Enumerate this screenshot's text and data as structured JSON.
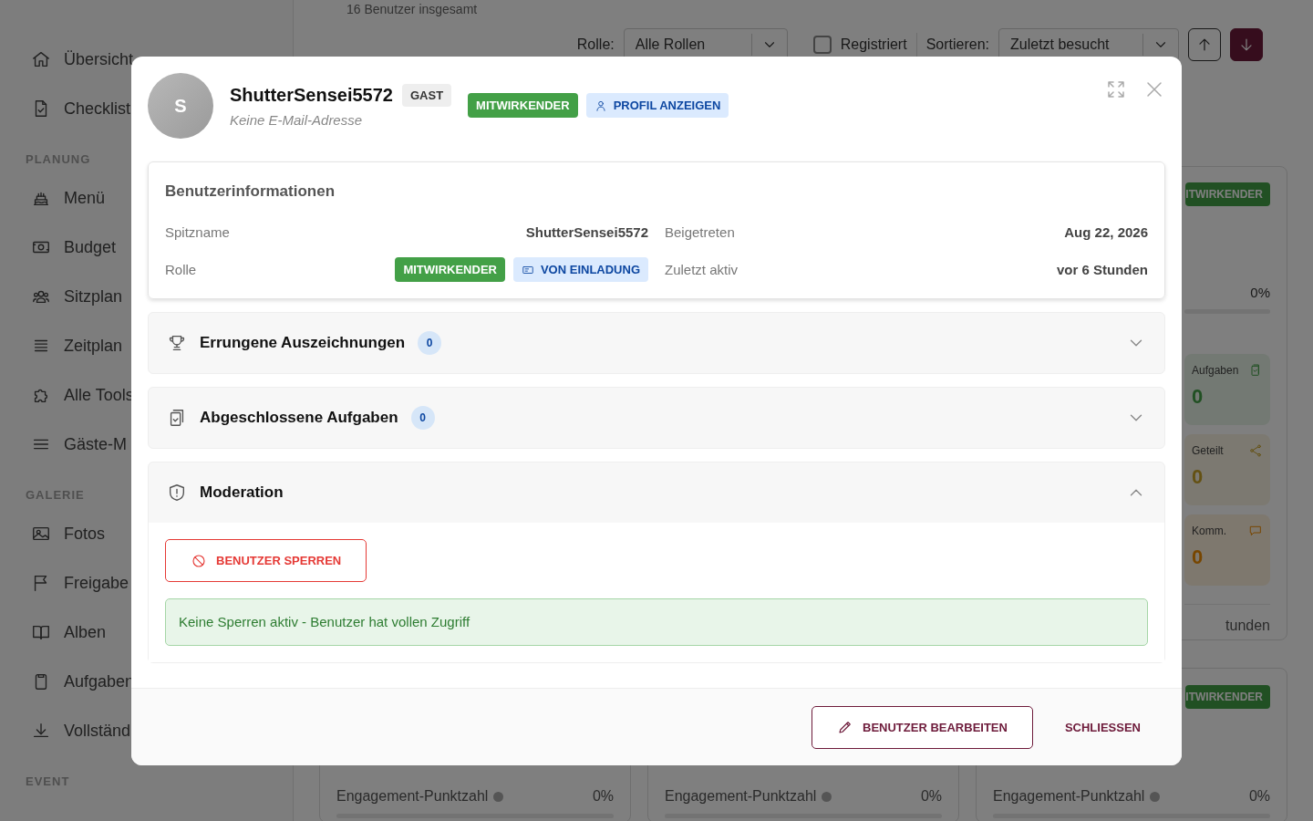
{
  "sidebar": {
    "sections": [
      {
        "items": [
          {
            "label": "Übersicht"
          },
          {
            "label": "Checklist"
          }
        ]
      },
      {
        "title": "PLANUNG",
        "items": [
          {
            "label": "Menü"
          },
          {
            "label": "Budget"
          },
          {
            "label": "Sitzplan"
          },
          {
            "label": "Zeitplan"
          },
          {
            "label": "Alle Tools"
          },
          {
            "label": "Gäste-M"
          }
        ]
      },
      {
        "title": "GALERIE",
        "items": [
          {
            "label": "Fotos"
          },
          {
            "label": "Freigabe"
          },
          {
            "label": "Alben"
          },
          {
            "label": "Aufgaben"
          },
          {
            "label": "Vollständ"
          }
        ]
      },
      {
        "title": "EVENT"
      }
    ]
  },
  "main": {
    "summary": "16 Benutzer insgesamt",
    "toolbar": {
      "role_label": "Rolle:",
      "role_value": "Alle Rollen",
      "registered": {
        "label": "Registriert",
        "checked": false
      },
      "sort_label": "Sortieren:",
      "sort_value": "Zuletzt besucht",
      "sort_directions": [
        {
          "kind": "up",
          "selected": false
        },
        {
          "kind": "down",
          "selected": true
        }
      ]
    },
    "top_card": {
      "badge": "ITWIRKENDER",
      "percent": "0%",
      "level": 0,
      "stats": [
        {
          "kind": "tasks",
          "label": "Aufgaben",
          "value": "0"
        },
        {
          "kind": "shared",
          "label": "Geteilt",
          "value": "0"
        },
        {
          "kind": "comments",
          "label": "Komm.",
          "value": "0"
        }
      ],
      "footer": "tunden"
    },
    "bottom_cards": [
      {
        "engagement": {
          "label": "Engagement-Punktzahl",
          "value": "0%",
          "level": 0
        }
      },
      {
        "engagement": {
          "label": "Engagement-Punktzahl",
          "value": "0%",
          "level": 0
        }
      },
      {
        "badge": "ITWIRKENDER",
        "engagement": {
          "label": "Engagement-Punktzahl",
          "value": "0%",
          "level": 0
        }
      }
    ]
  },
  "modal": {
    "avatar_initial": "S",
    "name": "ShutterSensei5572",
    "guest_badge": "GAST",
    "email": "Keine E-Mail-Adresse",
    "role_badge": "MITWIRKENDER",
    "profile_button": "PROFIL ANZEIGEN",
    "info": {
      "title": "Benutzerinformationen",
      "fields": [
        {
          "label": "Spitzname",
          "value": "ShutterSensei5572"
        },
        {
          "label": "Beigetreten",
          "value": "Aug 22, 2026"
        },
        {
          "label": "Rolle",
          "badges": [
            {
              "text": "MITWIRKENDER",
              "kind": "role"
            },
            {
              "text": "VON EINLADUNG",
              "kind": "invite"
            }
          ]
        },
        {
          "label": "Zuletzt aktiv",
          "value": "vor 6 Stunden"
        }
      ]
    },
    "sections": [
      {
        "kind": "awards",
        "title": "Errungene Auszeichnungen",
        "count": "0",
        "expanded": false
      },
      {
        "kind": "tasks",
        "title": "Abgeschlossene Aufgaben",
        "count": "0",
        "expanded": false
      },
      {
        "kind": "moderation",
        "title": "Moderation",
        "expanded": true,
        "ban_button": "BENUTZER SPERREN",
        "status": "Keine Sperren aktiv - Benutzer hat vollen Zugriff"
      }
    ],
    "actions": {
      "edit": "BENUTZER BEARBEITEN",
      "close": "SCHLIESSEN"
    }
  }
}
